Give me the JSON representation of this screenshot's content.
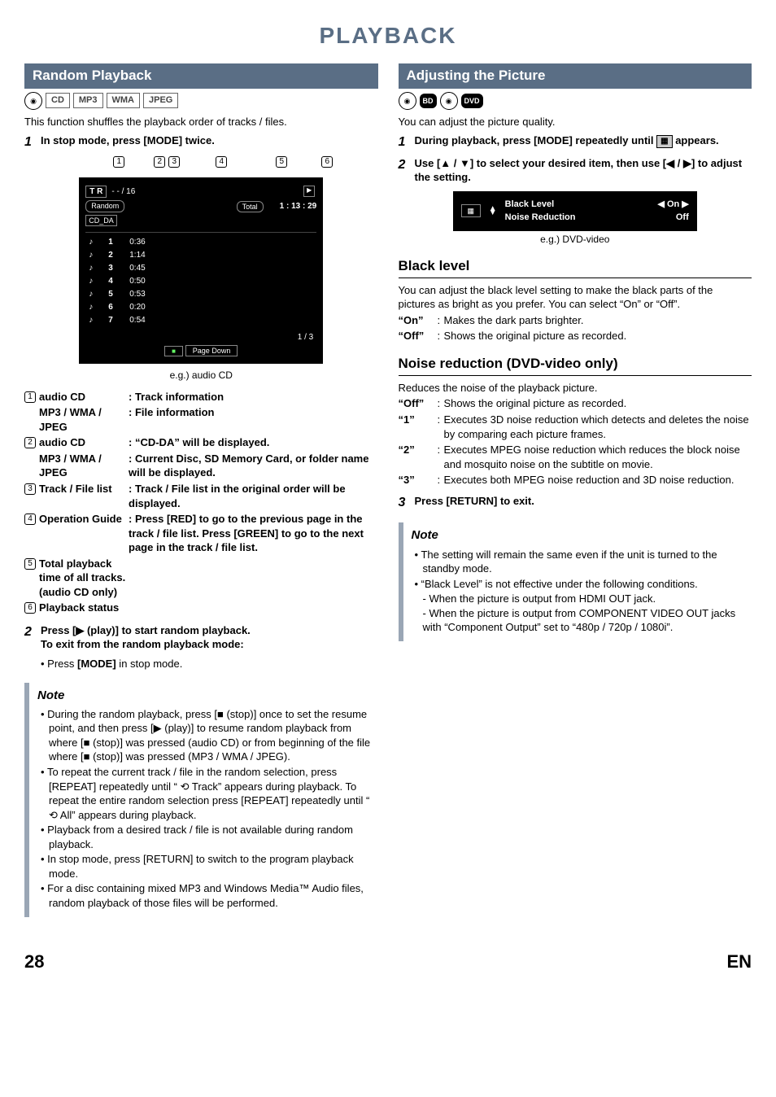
{
  "page_title": "PLAYBACK",
  "left": {
    "header": "Random Playback",
    "formats": [
      "CD",
      "MP3",
      "WMA",
      "JPEG"
    ],
    "intro": "This function shuffles the playback order of tracks / files.",
    "step1": "In stop mode, press [MODE] twice.",
    "callouts": [
      "1",
      "2",
      "3",
      "4",
      "5",
      "6"
    ],
    "osd": {
      "tr_label": "T R",
      "tr_value": "- - / 16",
      "random": "Random",
      "total_label": "Total",
      "total_value": "1 : 13 : 29",
      "cd_da": "CD_DA",
      "tracks": [
        {
          "n": "1",
          "t": "0:36"
        },
        {
          "n": "2",
          "t": "1:14"
        },
        {
          "n": "3",
          "t": "0:45"
        },
        {
          "n": "4",
          "t": "0:50"
        },
        {
          "n": "5",
          "t": "0:53"
        },
        {
          "n": "6",
          "t": "0:20"
        },
        {
          "n": "7",
          "t": "0:54"
        }
      ],
      "pager": "1   /   3",
      "page_down": "Page Down"
    },
    "caption": "e.g.) audio CD",
    "legend": [
      {
        "num": "1",
        "term": "audio CD",
        "desc": "Track information"
      },
      {
        "num": "",
        "term": "MP3 / WMA / JPEG",
        "desc": "File information"
      },
      {
        "num": "2",
        "term": "audio CD",
        "desc": "“CD-DA” will be displayed."
      },
      {
        "num": "",
        "term": "MP3 / WMA / JPEG",
        "desc": "Current Disc, SD Memory Card, or folder name will be displayed."
      },
      {
        "num": "3",
        "term": "Track / File list",
        "desc": "Track / File list in the original order will be displayed."
      },
      {
        "num": "4",
        "term": "Operation Guide",
        "desc": "Press [RED] to go to the previous page in the track / file list. Press [GREEN] to go to the next page in the track / file list."
      },
      {
        "num": "5",
        "term": "Total playback time of all tracks. (audio CD only)",
        "desc": ""
      },
      {
        "num": "6",
        "term": "Playback status",
        "desc": ""
      }
    ],
    "step2_l1": "Press [▶ (play)] to start random playback.",
    "step2_l2": "To exit from the random playback mode:",
    "step2_sub_prefix": "• Press ",
    "step2_sub_bold": "[MODE]",
    "step2_sub_suffix": " in stop mode.",
    "note_title": "Note",
    "notes": [
      "During the random playback, press [■ (stop)] once to set the resume point, and then press [▶ (play)] to resume random playback from where [■ (stop)] was pressed (audio CD) or from beginning of the file where [■ (stop)] was pressed (MP3 / WMA / JPEG).",
      "To repeat the current track / file in the random selection, press [REPEAT] repeatedly until “ ⟲ Track” appears during playback. To repeat the entire random selection press [REPEAT] repeatedly until “ ⟲ All” appears during playback.",
      "Playback from a desired track / file is not available during random playback.",
      "In stop mode, press [RETURN] to switch to the program playback mode.",
      "For a disc containing mixed MP3 and Windows Media™ Audio files, random playback of those files will be performed."
    ]
  },
  "right": {
    "header": "Adjusting the Picture",
    "formats": [
      "BD VIDEO",
      "DVD VIDEO"
    ],
    "intro": "You can adjust the picture quality.",
    "step1_a": "During playback, press [MODE] repeatedly until ",
    "step1_b": " appears.",
    "step2": "Use [▲ / ▼] to select your desired item, then use [◀ / ▶] to adjust the setting.",
    "osd2": {
      "row1_label": "Black Level",
      "row1_val": "◀  On  ▶",
      "row2_label": "Noise Reduction",
      "row2_val": "Off"
    },
    "caption2": "e.g.) DVD-video",
    "black_level_head": "Black level",
    "black_level_body": "You can adjust the black level setting to make the black parts of the pictures as bright as you prefer. You can select “On” or “Off”.",
    "bl_on_key": "“On”",
    "bl_on_val": "Makes the dark parts brighter.",
    "bl_off_key": "“Off”",
    "bl_off_val": "Shows the original picture as recorded.",
    "nr_head": "Noise reduction (DVD-video only)",
    "nr_body": "Reduces the noise of the playback picture.",
    "nr_items": [
      {
        "k": "“Off”",
        "v": "Shows the original picture as recorded."
      },
      {
        "k": "“1”",
        "v": "Executes 3D noise reduction which detects and deletes the noise by comparing each picture frames."
      },
      {
        "k": "“2”",
        "v": "Executes MPEG noise reduction which reduces the block noise and mosquito noise on the subtitle on movie."
      },
      {
        "k": "“3”",
        "v": "Executes both MPEG noise reduction and 3D noise reduction."
      }
    ],
    "step3": "Press [RETURN] to exit.",
    "note_title": "Note",
    "notes": [
      "The setting will remain the same even if the unit is turned to the standby mode.",
      "“Black Level” is not effective under the following conditions."
    ],
    "note_sub": [
      "- When the picture is output from HDMI OUT jack.",
      "- When the picture is output from COMPONENT VIDEO OUT jacks with “Component Output” set to “480p / 720p / 1080i”."
    ]
  },
  "footer": {
    "page": "28",
    "lang": "EN"
  }
}
